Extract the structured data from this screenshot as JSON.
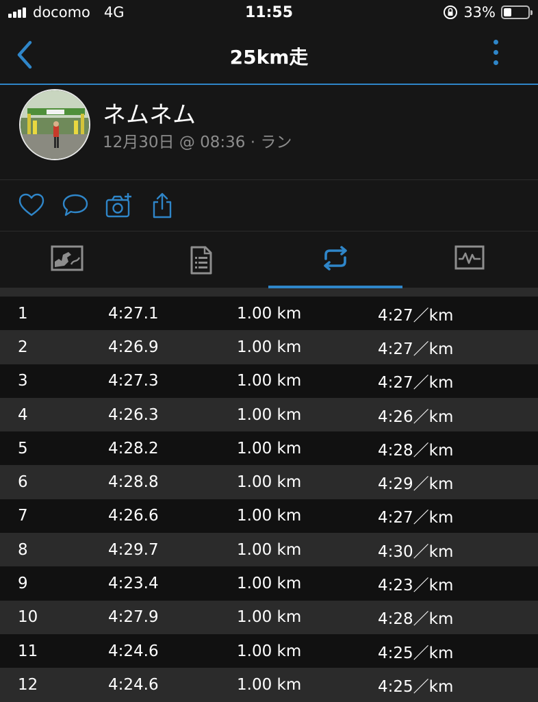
{
  "status_bar": {
    "carrier": "docomo",
    "network": "4G",
    "time": "11:55",
    "battery_percent": "33%",
    "battery_level": 0.33
  },
  "nav": {
    "title": "25km走",
    "back_icon": "chevron-left-icon",
    "more_icon": "more-vertical-icon"
  },
  "profile": {
    "name": "ネムネム",
    "meta": "12月30日 @ 08:36 · ラン"
  },
  "actions": [
    "heart-icon",
    "comment-icon",
    "add-photo-icon",
    "share-icon"
  ],
  "tabs": [
    {
      "icon": "map-icon",
      "active": false
    },
    {
      "icon": "details-icon",
      "active": false
    },
    {
      "icon": "laps-icon",
      "active": true
    },
    {
      "icon": "chart-icon",
      "active": false
    }
  ],
  "colors": {
    "accent": "#2f86c9",
    "background": "#161616",
    "row_dark": "#111111",
    "row_light": "#2b2b2b",
    "meta_text": "#8c8c8c"
  },
  "laps": [
    {
      "num": "1",
      "time": "4:27.1",
      "distance": "1.00 km",
      "pace": "4:27／km"
    },
    {
      "num": "2",
      "time": "4:26.9",
      "distance": "1.00 km",
      "pace": "4:27／km"
    },
    {
      "num": "3",
      "time": "4:27.3",
      "distance": "1.00 km",
      "pace": "4:27／km"
    },
    {
      "num": "4",
      "time": "4:26.3",
      "distance": "1.00 km",
      "pace": "4:26／km"
    },
    {
      "num": "5",
      "time": "4:28.2",
      "distance": "1.00 km",
      "pace": "4:28／km"
    },
    {
      "num": "6",
      "time": "4:28.8",
      "distance": "1.00 km",
      "pace": "4:29／km"
    },
    {
      "num": "7",
      "time": "4:26.6",
      "distance": "1.00 km",
      "pace": "4:27／km"
    },
    {
      "num": "8",
      "time": "4:29.7",
      "distance": "1.00 km",
      "pace": "4:30／km"
    },
    {
      "num": "9",
      "time": "4:23.4",
      "distance": "1.00 km",
      "pace": "4:23／km"
    },
    {
      "num": "10",
      "time": "4:27.9",
      "distance": "1.00 km",
      "pace": "4:28／km"
    },
    {
      "num": "11",
      "time": "4:24.6",
      "distance": "1.00 km",
      "pace": "4:25／km"
    },
    {
      "num": "12",
      "time": "4:24.6",
      "distance": "1.00 km",
      "pace": "4:25／km"
    }
  ]
}
